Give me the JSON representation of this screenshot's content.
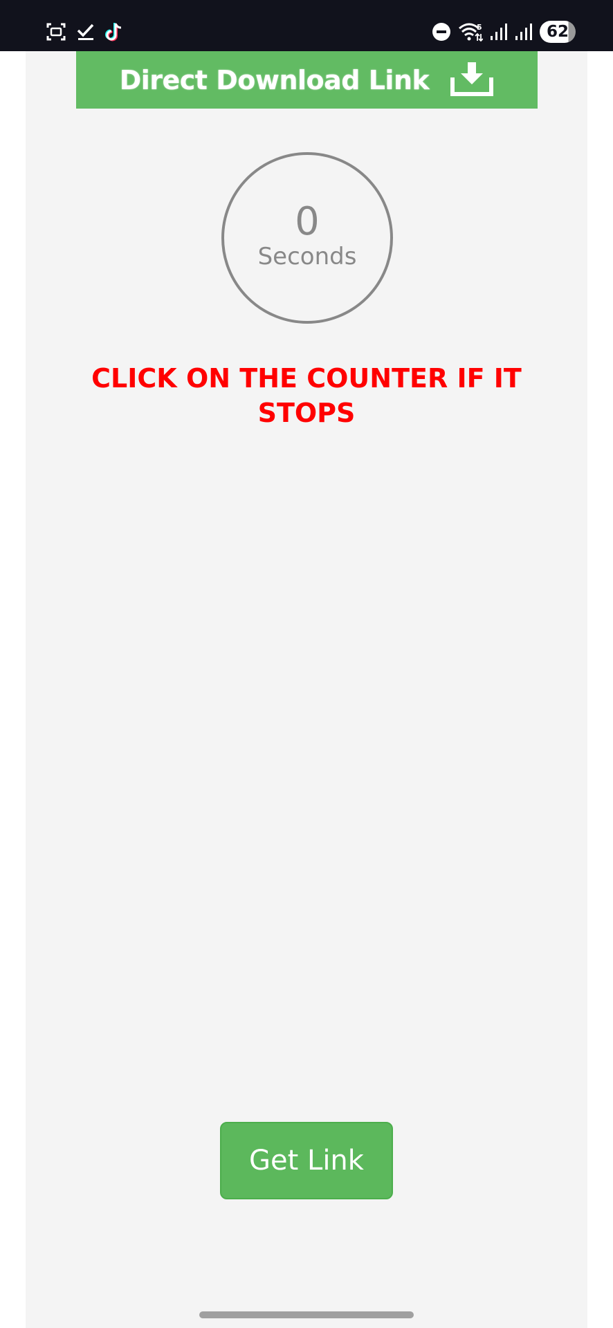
{
  "status_bar": {
    "left_icons": [
      "screenshot-icon",
      "checkmark-icon",
      "tiktok-icon"
    ],
    "right_icons": [
      "do-not-disturb-icon",
      "wifi-icon",
      "signal-icon",
      "signal-icon"
    ],
    "battery": "62"
  },
  "banner": {
    "label": "Direct Download Link",
    "icon": "download-icon",
    "color": "#62bb63"
  },
  "counter": {
    "value": "0",
    "unit": "Seconds"
  },
  "warning": {
    "text": "CLICK ON THE COUNTER IF IT STOPS",
    "color": "#ff0000"
  },
  "actions": {
    "get_link_label": "Get Link",
    "color": "#5cb85c"
  }
}
